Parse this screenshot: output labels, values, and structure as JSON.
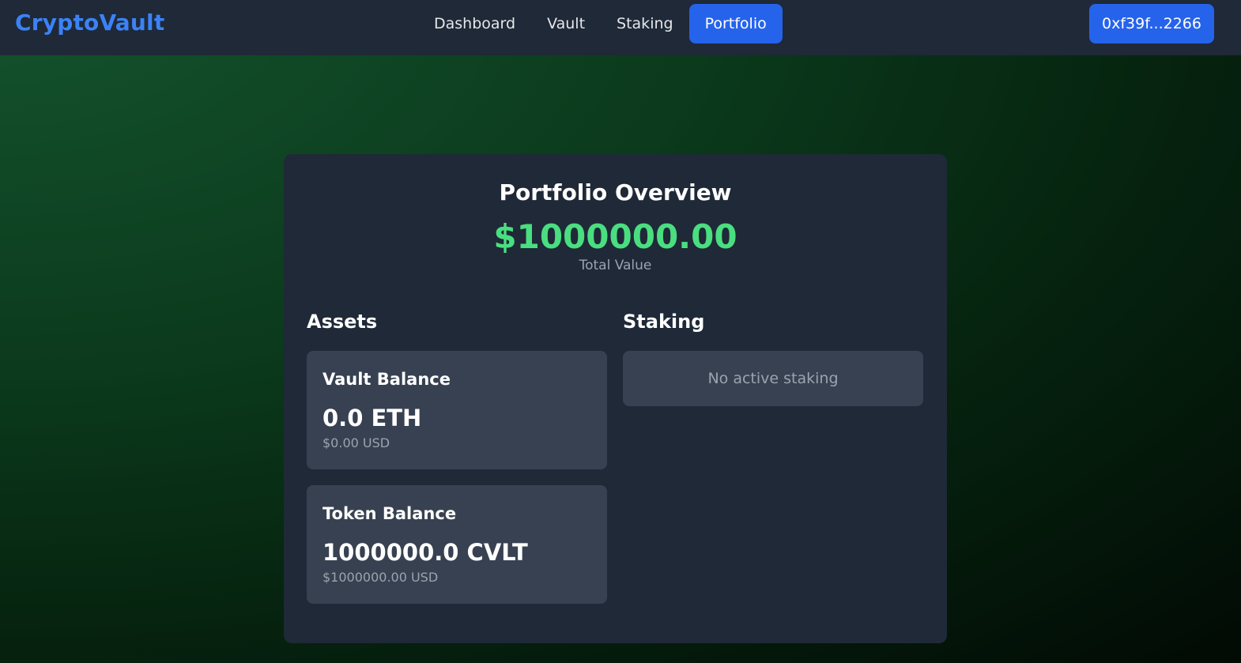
{
  "navbar": {
    "brand": "CryptoVault",
    "links": [
      {
        "label": "Dashboard",
        "active": false
      },
      {
        "label": "Vault",
        "active": false
      },
      {
        "label": "Staking",
        "active": false
      },
      {
        "label": "Portfolio",
        "active": true
      }
    ],
    "wallet_address": "0xf39f...2266"
  },
  "portfolio": {
    "title": "Portfolio Overview",
    "total_value": "$1000000.00",
    "total_label": "Total Value",
    "assets": {
      "heading": "Assets",
      "items": [
        {
          "name": "Vault Balance",
          "amount": "0.0 ETH",
          "usd": "$0.00 USD"
        },
        {
          "name": "Token Balance",
          "amount": "1000000.0 CVLT",
          "usd": "$1000000.00 USD"
        }
      ]
    },
    "staking": {
      "heading": "Staking",
      "empty_message": "No active staking"
    }
  },
  "colors": {
    "accent": "#2563eb",
    "brand": "#3b82f6",
    "positive": "#4ade80",
    "panel": "#1f2937",
    "subpanel": "#374151",
    "muted_text": "#9ca3af"
  }
}
